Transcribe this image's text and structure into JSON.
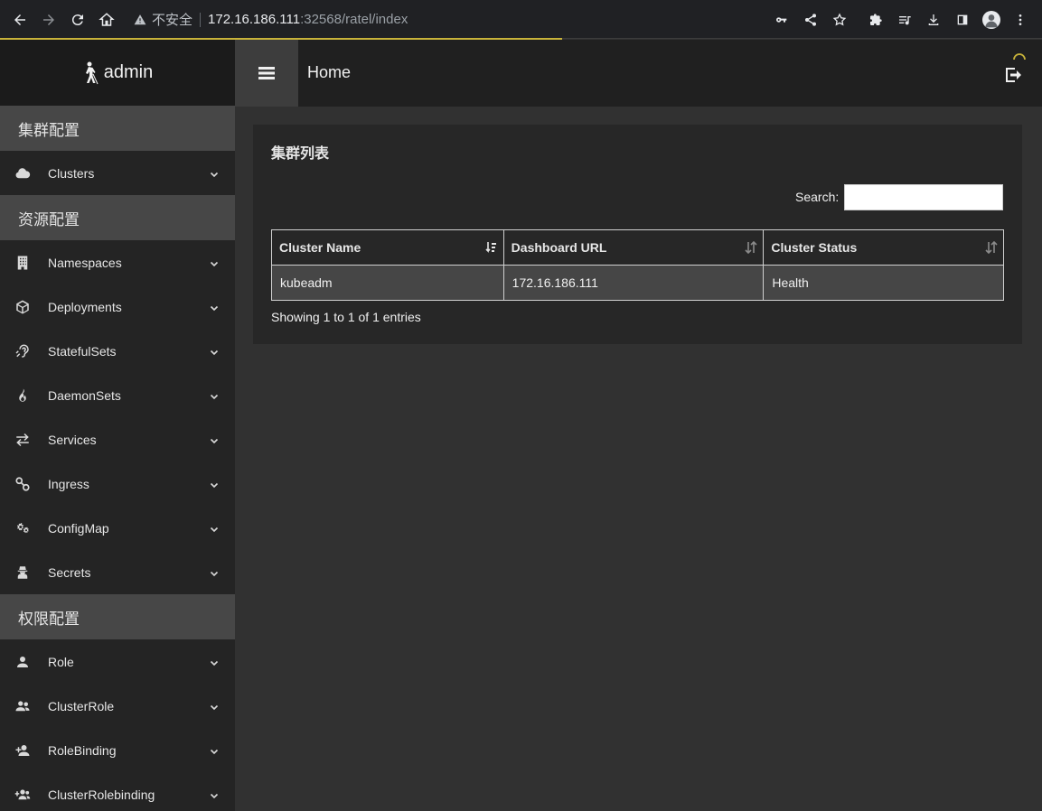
{
  "browser": {
    "security_label": "不安全",
    "url_host": "172.16.186.111",
    "url_path": ":32568/ratel/index"
  },
  "sidebar": {
    "brand": "admin",
    "sections": [
      {
        "title": "集群配置",
        "items": [
          {
            "label": "Clusters",
            "icon": "cloud-icon"
          }
        ]
      },
      {
        "title": "资源配置",
        "items": [
          {
            "label": "Namespaces",
            "icon": "building-icon"
          },
          {
            "label": "Deployments",
            "icon": "cube-icon"
          },
          {
            "label": "StatefulSets",
            "icon": "assistive-listening-icon"
          },
          {
            "label": "DaemonSets",
            "icon": "fire-icon"
          },
          {
            "label": "Services",
            "icon": "exchange-icon"
          },
          {
            "label": "Ingress",
            "icon": "link-icon"
          },
          {
            "label": "ConfigMap",
            "icon": "cogs-icon"
          },
          {
            "label": "Secrets",
            "icon": "user-secret-icon"
          }
        ]
      },
      {
        "title": "权限配置",
        "items": [
          {
            "label": "Role",
            "icon": "user-icon"
          },
          {
            "label": "ClusterRole",
            "icon": "users-icon"
          },
          {
            "label": "RoleBinding",
            "icon": "user-plus-icon"
          },
          {
            "label": "ClusterRolebinding",
            "icon": "users-plus-icon"
          }
        ]
      }
    ]
  },
  "header": {
    "title": "Home"
  },
  "main": {
    "card_title": "集群列表",
    "search_label": "Search:",
    "search_value": "",
    "table": {
      "columns": [
        "Cluster Name",
        "Dashboard URL",
        "Cluster Status"
      ],
      "rows": [
        [
          "kubeadm",
          "172.16.186.111",
          "Health"
        ]
      ]
    },
    "info": "Showing 1 to 1 of 1 entries"
  }
}
